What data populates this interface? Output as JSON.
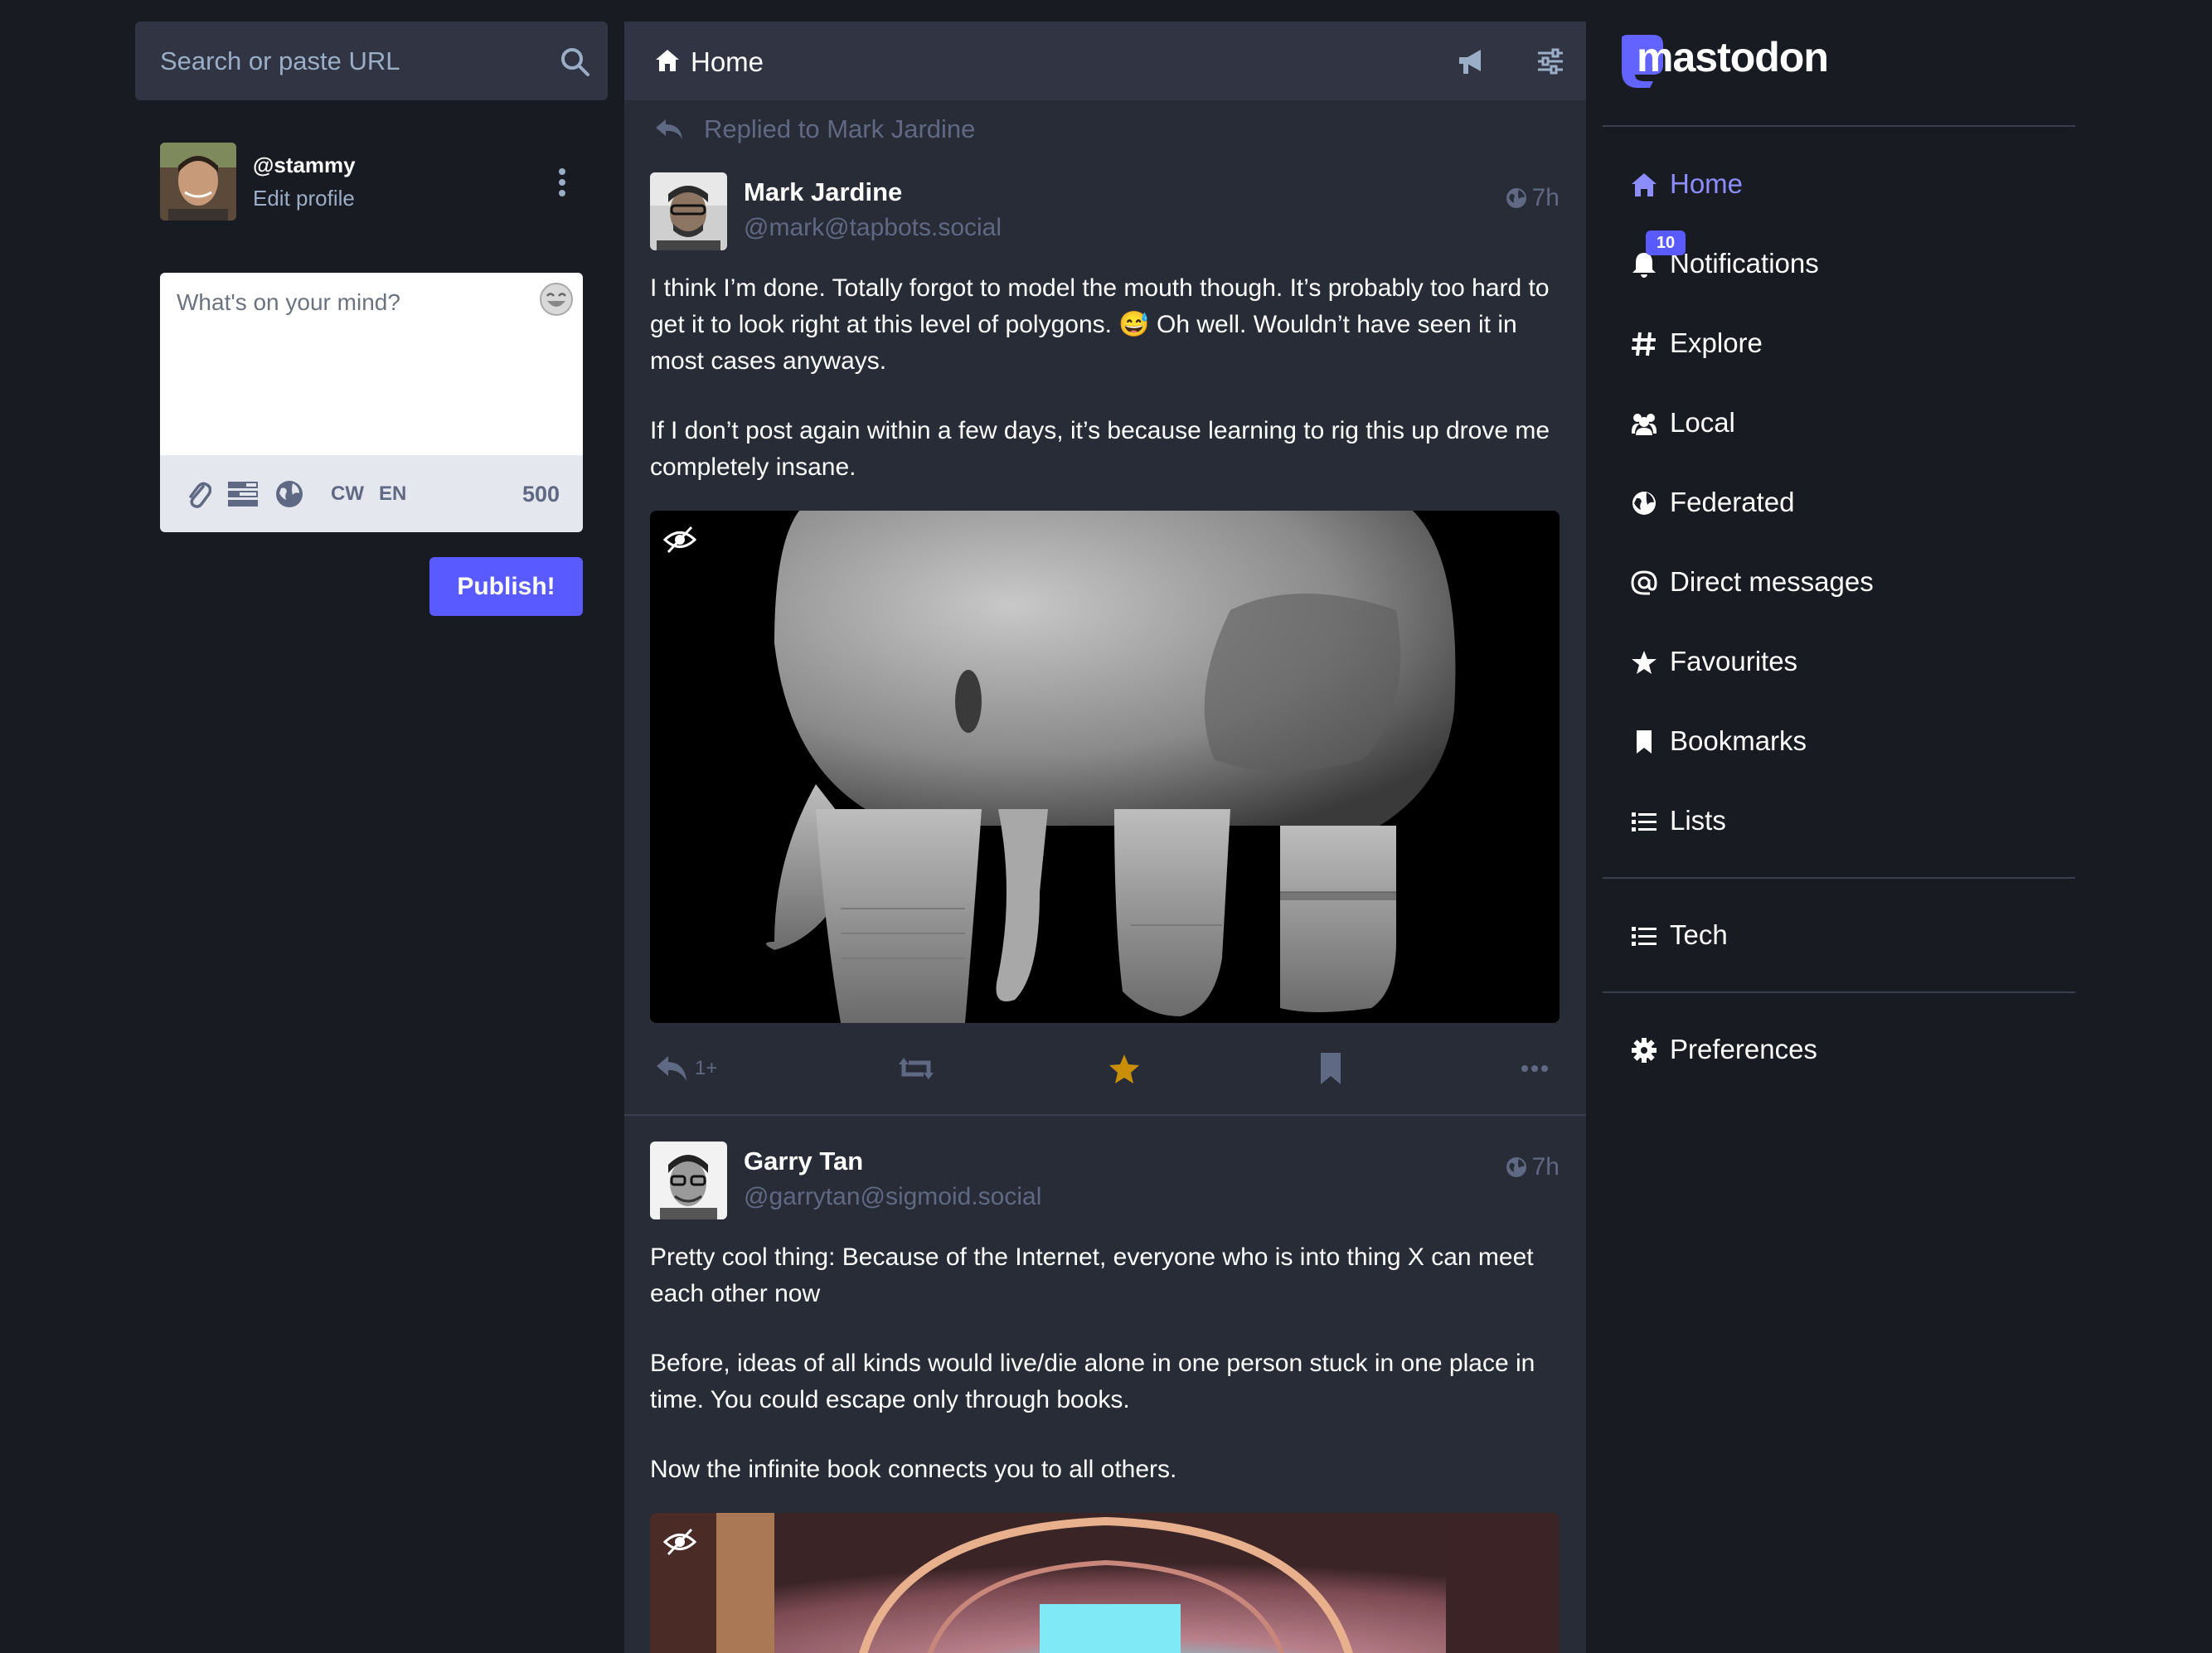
{
  "colors": {
    "background": "#191b22",
    "column": "#282c37",
    "header": "#313543",
    "accent": "#595aff",
    "accent_text": "#8c8dff",
    "muted": "#606984",
    "favourite": "#ca8f04"
  },
  "search": {
    "placeholder": "Search or paste URL",
    "icon": "search-icon"
  },
  "account": {
    "handle": "@stammy",
    "edit_label": "Edit profile"
  },
  "compose": {
    "placeholder": "What's on your mind?",
    "tools": {
      "cw": "CW",
      "language": "EN"
    },
    "char_count": "500",
    "publish_label": "Publish!"
  },
  "column": {
    "title": "Home"
  },
  "posts": [
    {
      "replied_to": "Replied to Mark Jardine",
      "name": "Mark Jardine",
      "handle": "@mark@tapbots.social",
      "time": "7h",
      "paragraphs": [
        "I think I’m done. Totally forgot to model the mouth though. It’s probably  too hard to get it to look right at this level of polygons. 😅 Oh well. Wouldn’t have seen it in most cases anyways.",
        "If I don’t post again within a few days, it’s because learning to rig this up drove me completely insane."
      ],
      "reply_count": "1+",
      "favourited": true
    },
    {
      "name": "Garry Tan",
      "handle": "@garrytan@sigmoid.social",
      "time": "7h",
      "paragraphs": [
        "Pretty cool thing: Because of the Internet, everyone who is into thing X can meet each other now",
        "Before, ideas of all kinds would live/die alone in one person stuck in one place in time. You could escape only through books.",
        "Now the infinite book connects you to all others."
      ]
    }
  ],
  "nav": {
    "logo": "mastodon",
    "notifications_badge": "10",
    "items": [
      {
        "label": "Home",
        "icon": "home-icon"
      },
      {
        "label": "Notifications",
        "icon": "bell-icon"
      },
      {
        "label": "Explore",
        "icon": "hashtag-icon"
      },
      {
        "label": "Local",
        "icon": "users-icon"
      },
      {
        "label": "Federated",
        "icon": "globe-icon"
      },
      {
        "label": "Direct messages",
        "icon": "at-icon"
      },
      {
        "label": "Favourites",
        "icon": "star-icon"
      },
      {
        "label": "Bookmarks",
        "icon": "bookmark-icon"
      },
      {
        "label": "Lists",
        "icon": "list-icon"
      },
      {
        "label": "Tech",
        "icon": "list-icon"
      },
      {
        "label": "Preferences",
        "icon": "gear-icon"
      }
    ]
  }
}
